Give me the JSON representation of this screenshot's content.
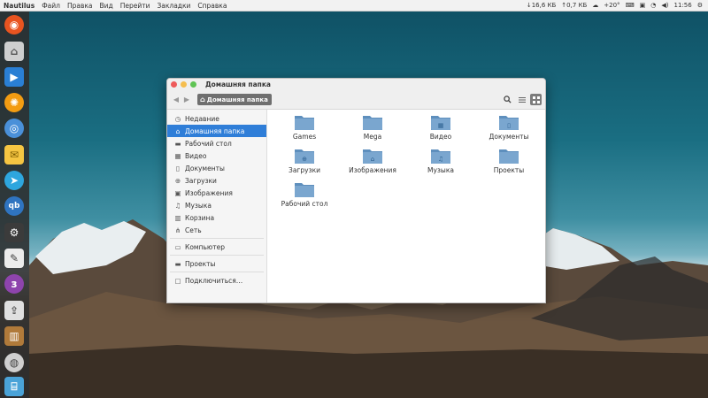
{
  "topbar": {
    "app_name": "Nautilus",
    "menus": [
      "Файл",
      "Правка",
      "Вид",
      "Перейти",
      "Закладки",
      "Справка"
    ],
    "net_down": "↓16,6 КБ",
    "net_up": "↑0,7 КБ",
    "weather": "+20°",
    "time": "11:56"
  },
  "window": {
    "title": "Домашняя папка",
    "path_button": "Домашняя папка"
  },
  "sidebar": {
    "items": [
      {
        "label": "Недавние",
        "icon": "clock-icon"
      },
      {
        "label": "Домашняя папка",
        "icon": "home-icon",
        "selected": true
      },
      {
        "label": "Рабочий стол",
        "icon": "folder-icon"
      },
      {
        "label": "Видео",
        "icon": "video-icon"
      },
      {
        "label": "Документы",
        "icon": "document-icon"
      },
      {
        "label": "Загрузки",
        "icon": "download-icon"
      },
      {
        "label": "Изображения",
        "icon": "image-icon"
      },
      {
        "label": "Музыка",
        "icon": "music-icon"
      },
      {
        "label": "Корзина",
        "icon": "trash-icon"
      },
      {
        "label": "Сеть",
        "icon": "network-icon"
      }
    ],
    "computer": "Компьютер",
    "projects": "Проекты",
    "connect": "Подключиться…"
  },
  "files": [
    {
      "label": "Games",
      "emblem": ""
    },
    {
      "label": "Mega",
      "emblem": ""
    },
    {
      "label": "Видео",
      "emblem": "video"
    },
    {
      "label": "Документы",
      "emblem": "document"
    },
    {
      "label": "Загрузки",
      "emblem": "download"
    },
    {
      "label": "Изображения",
      "emblem": "image"
    },
    {
      "label": "Музыка",
      "emblem": "music"
    },
    {
      "label": "Проекты",
      "emblem": ""
    },
    {
      "label": "Рабочий стол",
      "emblem": ""
    }
  ],
  "colors": {
    "selection": "#2f7ed8",
    "folder": "#7aa6cf",
    "close": "#ee5b5b",
    "minimize": "#f5be4f",
    "maximize": "#5fc454"
  }
}
